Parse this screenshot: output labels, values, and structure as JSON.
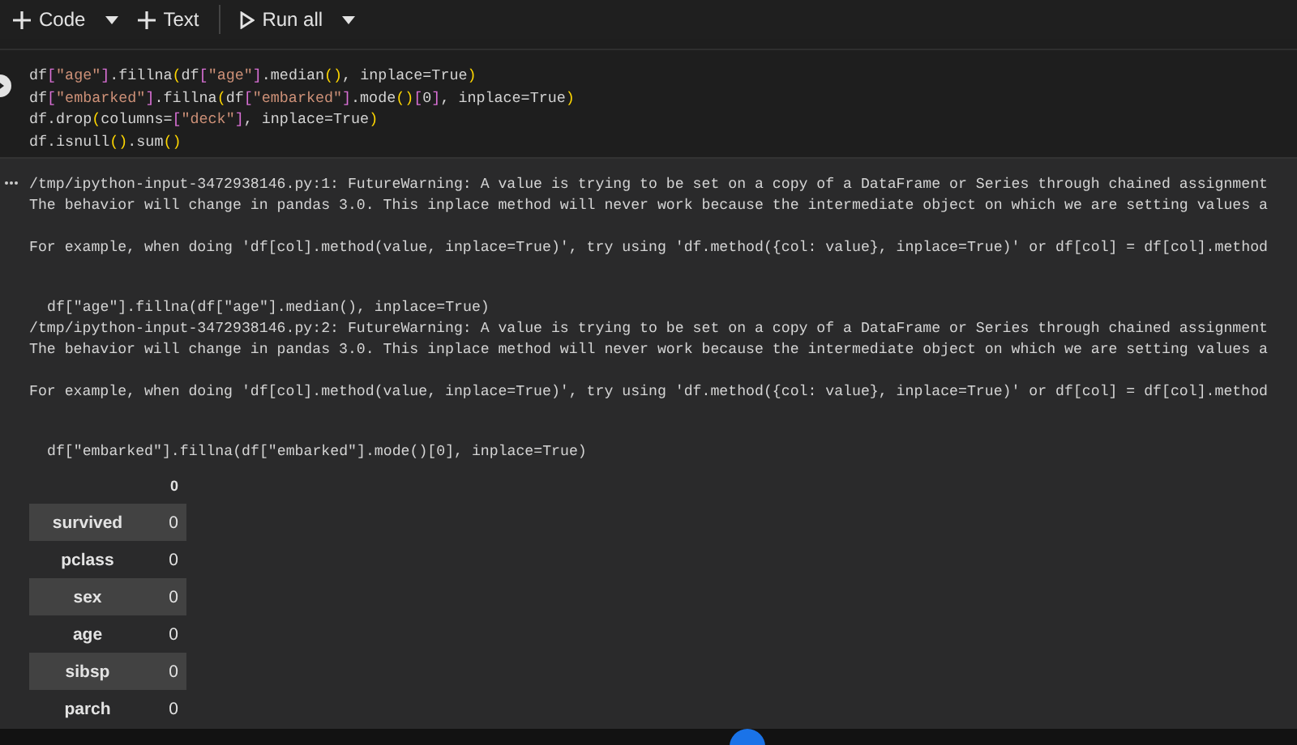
{
  "toolbar": {
    "buttons": [
      {
        "kind": "add",
        "label": "Code",
        "dropdown": true
      },
      {
        "kind": "add",
        "label": "Text",
        "dropdown": false
      },
      {
        "kind": "run",
        "label": "Run all",
        "dropdown": true
      }
    ]
  },
  "code_cell": {
    "lines": [
      "df[\"age\"].fillna(df[\"age\"].median(), inplace=True)",
      "df[\"embarked\"].fillna(df[\"embarked\"].mode()[0], inplace=True)",
      "df.drop(columns=[\"deck\"], inplace=True)",
      "df.isnull().sum()"
    ]
  },
  "output": {
    "blocks": [
      {
        "kind": "warning",
        "paragraphs": [
          [
            "/tmp/ipython-input-3472938146.py:1: FutureWarning: A value is trying to be set on a copy of a DataFrame or Series through chained assignment",
            "The behavior will change in pandas 3.0. This inplace method will never work because the intermediate object on which we are setting values a"
          ],
          [
            "For example, when doing 'df[col].method(value, inplace=True)', try using 'df.method({col: value}, inplace=True)' or df[col] = df[col].method"
          ]
        ]
      },
      {
        "kind": "source",
        "text": "df[\"age\"].fillna(df[\"age\"].median(), inplace=True)"
      },
      {
        "kind": "warning",
        "paragraphs": [
          [
            "/tmp/ipython-input-3472938146.py:2: FutureWarning: A value is trying to be set on a copy of a DataFrame or Series through chained assignment",
            "The behavior will change in pandas 3.0. This inplace method will never work because the intermediate object on which we are setting values a"
          ],
          [
            "For example, when doing 'df[col].method(value, inplace=True)', try using 'df.method({col: value}, inplace=True)' or df[col] = df[col].method"
          ]
        ]
      },
      {
        "kind": "source",
        "text": "df[\"embarked\"].fillna(df[\"embarked\"].mode()[0], inplace=True)"
      }
    ],
    "table": {
      "columns": [
        "0"
      ],
      "rows": [
        {
          "label": "survived",
          "value": "0"
        },
        {
          "label": "pclass",
          "value": "0"
        },
        {
          "label": "sex",
          "value": "0"
        },
        {
          "label": "age",
          "value": "0"
        },
        {
          "label": "sibsp",
          "value": "0"
        },
        {
          "label": "parch",
          "value": "0"
        }
      ]
    }
  }
}
